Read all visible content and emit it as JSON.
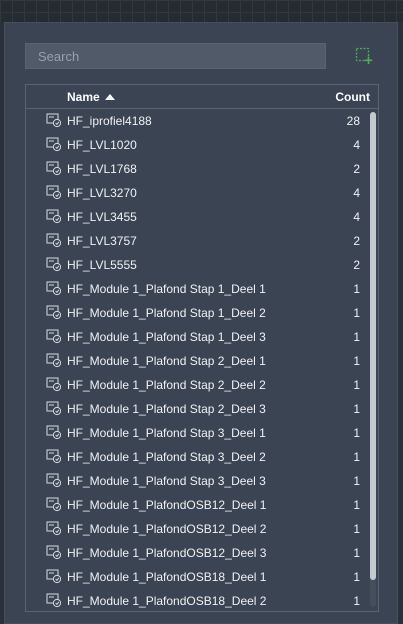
{
  "search": {
    "placeholder": "Search"
  },
  "table": {
    "headers": {
      "name": "Name",
      "count": "Count"
    },
    "sort": "ascending",
    "rows": [
      {
        "name": "HF_iprofiel4188",
        "count": "28"
      },
      {
        "name": "HF_LVL1020",
        "count": "4"
      },
      {
        "name": "HF_LVL1768",
        "count": "2"
      },
      {
        "name": "HF_LVL3270",
        "count": "4"
      },
      {
        "name": "HF_LVL3455",
        "count": "4"
      },
      {
        "name": "HF_LVL3757",
        "count": "2"
      },
      {
        "name": "HF_LVL5555",
        "count": "2"
      },
      {
        "name": "HF_Module 1_Plafond Stap 1_Deel 1",
        "count": "1"
      },
      {
        "name": "HF_Module 1_Plafond Stap 1_Deel 2",
        "count": "1"
      },
      {
        "name": "HF_Module 1_Plafond Stap 1_Deel 3",
        "count": "1"
      },
      {
        "name": "HF_Module 1_Plafond Stap 2_Deel 1",
        "count": "1"
      },
      {
        "name": "HF_Module 1_Plafond Stap 2_Deel 2",
        "count": "1"
      },
      {
        "name": "HF_Module 1_Plafond Stap 2_Deel 3",
        "count": "1"
      },
      {
        "name": "HF_Module 1_Plafond Stap 3_Deel 1",
        "count": "1"
      },
      {
        "name": "HF_Module 1_Plafond Stap 3_Deel 2",
        "count": "1"
      },
      {
        "name": "HF_Module 1_Plafond Stap 3_Deel 3",
        "count": "1"
      },
      {
        "name": "HF_Module 1_PlafondOSB12_Deel 1",
        "count": "1"
      },
      {
        "name": "HF_Module 1_PlafondOSB12_Deel 2",
        "count": "1"
      },
      {
        "name": "HF_Module 1_PlafondOSB12_Deel 3",
        "count": "1"
      },
      {
        "name": "HF_Module 1_PlafondOSB18_Deel 1",
        "count": "1"
      },
      {
        "name": "HF_Module 1_PlafondOSB18_Deel 2",
        "count": "1"
      }
    ]
  },
  "icons": {
    "row": "block-reference-icon",
    "add": "add-selection-icon"
  },
  "colors": {
    "panel": "#3b4453",
    "accent": "#4caf50"
  }
}
